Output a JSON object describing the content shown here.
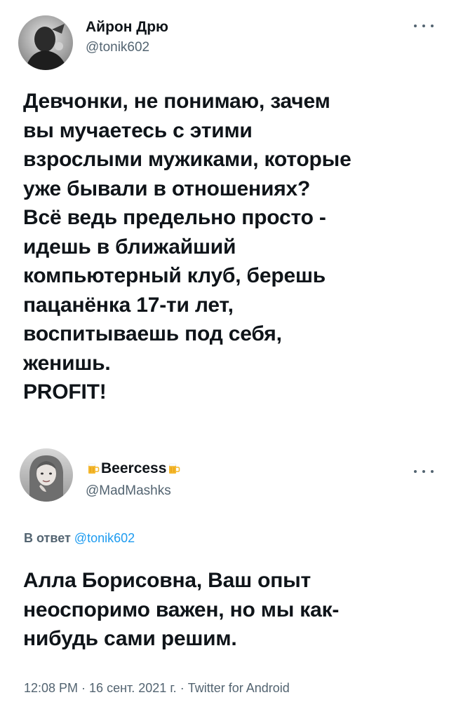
{
  "tweet_1": {
    "display_name": "Айрон Дрю",
    "handle": "@tonik602",
    "text": "Девчонки, не понимаю, зачем\nвы мучаетесь с этими\nвзрослыми мужиками, которые\nуже бывали в отношениях?\nВсё ведь предельно просто -\nидешь в ближайший\nкомпьютерный клуб, берешь\nпацанёнка 17-ти лет,\nвоспитываешь под себя,\nженишь.\nPROFIT!"
  },
  "tweet_2": {
    "display_name": "Beercess",
    "display_name_emoji": "beer-mug-icon",
    "handle": "@MadMashks",
    "reply_label": "В ответ",
    "reply_to": "@tonik602",
    "text": "Алла Борисовна, Ваш опыт\nнеоспоримо важен, но мы как-\nнибудь сами решим.",
    "time": "12:08 PM",
    "date": "16 сент. 2021 г.",
    "source": "Twitter for Android",
    "separator": "·"
  },
  "colors": {
    "text_primary": "#0f1419",
    "text_secondary": "#536471",
    "link": "#1d9bf0",
    "background": "#ffffff"
  }
}
